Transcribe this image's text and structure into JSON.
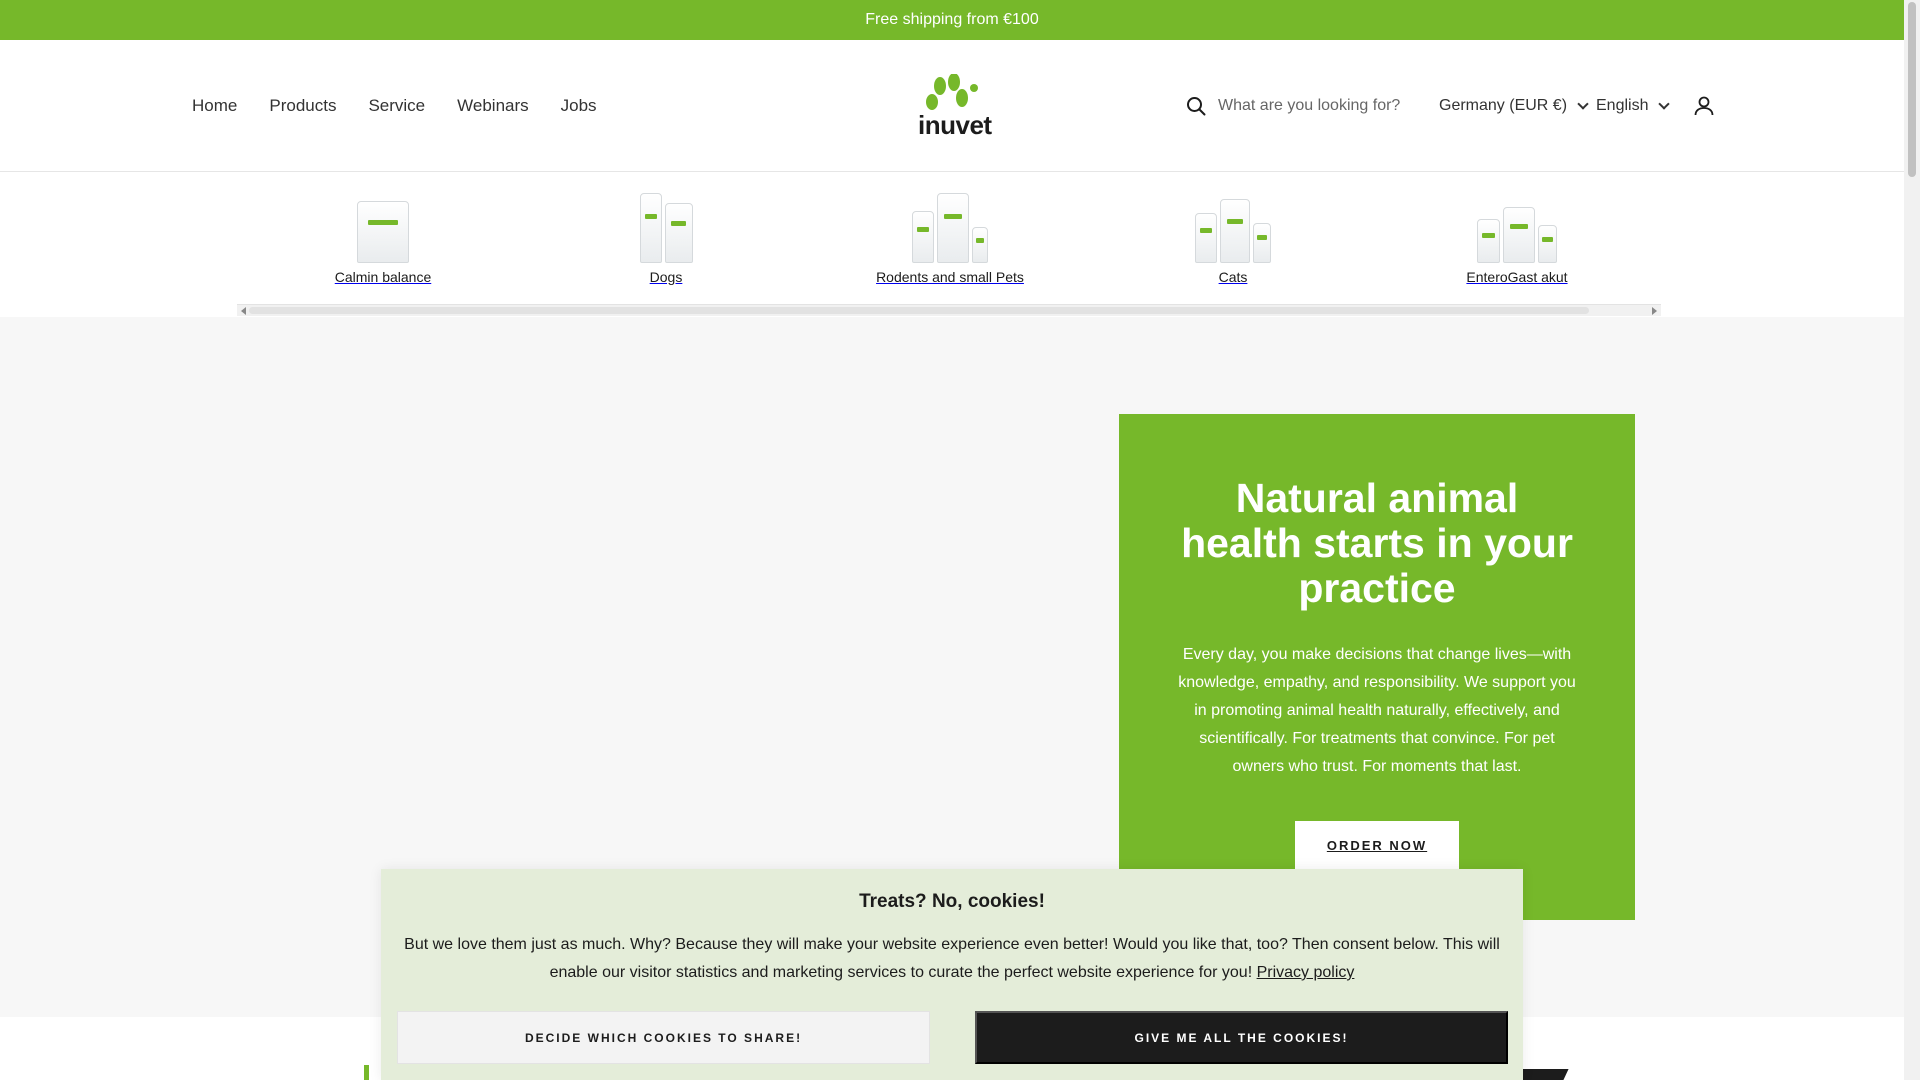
{
  "announcement": {
    "text": "Free shipping from €100"
  },
  "header": {
    "nav": [
      {
        "label": "Home"
      },
      {
        "label": "Products"
      },
      {
        "label": "Service"
      },
      {
        "label": "Webinars"
      },
      {
        "label": "Jobs"
      }
    ],
    "logo_text": "inuvet",
    "search": {
      "placeholder": "What are you looking for?",
      "icon": "search-icon"
    },
    "country": "Germany (EUR €)",
    "language": "English",
    "account_icon": "user-icon"
  },
  "collections": [
    {
      "label": "Calmin balance"
    },
    {
      "label": "Dogs"
    },
    {
      "label": "Rodents and small Pets"
    },
    {
      "label": "Cats"
    },
    {
      "label": "EnteroGast akut"
    }
  ],
  "hero": {
    "title": "Natural animal health starts in your practice",
    "body": "Every day, you make decisions that change lives—with knowledge, empathy, and responsibility. We support you in promoting animal health naturally, effectively, and scientifically. For treatments that convince. For pet owners who trust. For moments that last.",
    "cta": "ORDER NOW"
  },
  "cookie": {
    "title": "Treats? No, cookies!",
    "body": "But we love them just as much. Why? Because they will make your website experience even better! Would you like that, too? Then consent below. This will enable our visitor statistics and marketing services to curate the perfect website experience for you! ",
    "privacy_link": "Privacy policy",
    "decide_button": "DECIDE WHICH COOKIES TO SHARE!",
    "accept_all_button": "GIVE ME ALL THE COOKIES!"
  },
  "colors": {
    "brand_green": "#76b82a",
    "dark": "#1c1c1c",
    "cookie_bg": "#e4edd9"
  }
}
